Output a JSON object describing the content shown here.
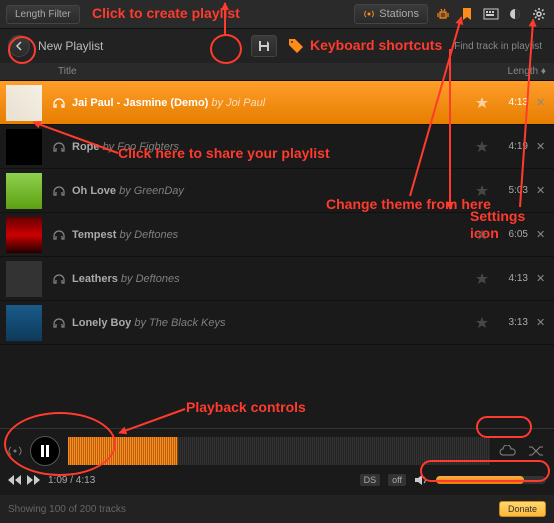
{
  "header": {
    "length_filter": "Length Filter",
    "stations": "Stations"
  },
  "toolbar": {
    "playlist_name": "New Playlist",
    "search_placeholder": "Find track in playlist"
  },
  "table": {
    "title": "Title",
    "length": "Length"
  },
  "tracks": [
    {
      "title": "Jai Paul - Jasmine (Demo)",
      "artist": "Joi Paul",
      "length": "4:13",
      "selected": true,
      "art": "art1"
    },
    {
      "title": "Rope",
      "artist": "Foo Fighters",
      "length": "4:19",
      "selected": false,
      "art": "art2"
    },
    {
      "title": "Oh Love",
      "artist": "GreenDay",
      "length": "5:03",
      "selected": false,
      "art": "art3"
    },
    {
      "title": "Tempest",
      "artist": "Deftones",
      "length": "6:05",
      "selected": false,
      "art": "art4"
    },
    {
      "title": "Leathers",
      "artist": "Deftones",
      "length": "4:13",
      "selected": false,
      "art": "art5"
    },
    {
      "title": "Lonely Boy",
      "artist": "The Black Keys",
      "length": "3:13",
      "selected": false,
      "art": "art6"
    }
  ],
  "player": {
    "time": "1:09 / 4:13",
    "ds": "DS",
    "off": "off"
  },
  "footer": {
    "showing": "Showing 100 of 200 tracks",
    "donate": "Donate"
  },
  "annotations": {
    "create_playlist": "Click to create playlist",
    "share_playlist": "Click here to share your playlist",
    "keyboard": "Keyboard shortcuts",
    "theme": "Change theme from here",
    "settings": "Settings icon",
    "playback": "Playback controls"
  }
}
